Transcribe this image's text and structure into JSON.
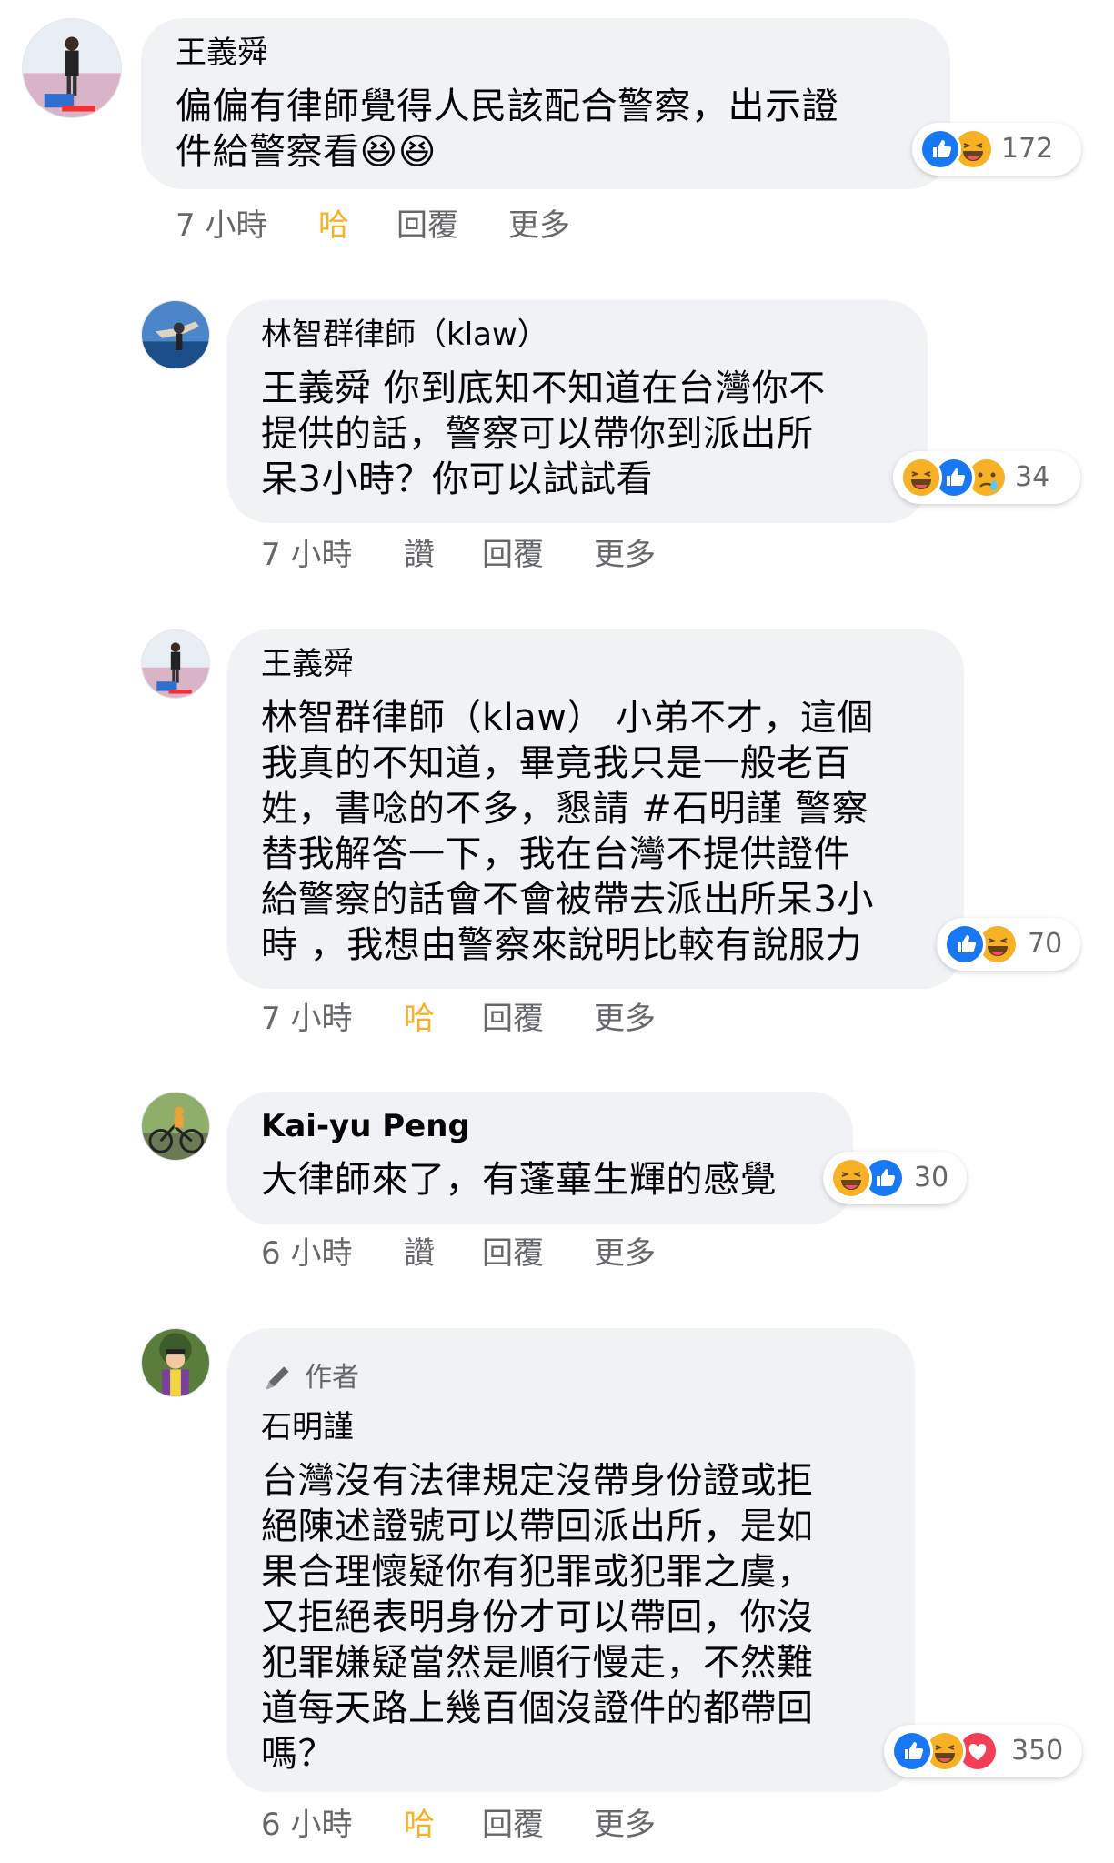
{
  "comments": [
    {
      "author": "王義舜",
      "text": "偏偏有律師覺得人民該配合警察，出示證\n件給警察看😆😆",
      "reactions": [
        "like",
        "haha"
      ],
      "reaction_count": "172",
      "time": "7 小時",
      "reaction_label": "哈",
      "reply_label": "回覆",
      "more_label": "更多"
    },
    {
      "author": "林智群律師（klaw）",
      "text": "王義舜 你到底知不知道在台灣你不\n提供的話，警察可以帶你到派出所\n呆3小時？你可以試試看",
      "reactions": [
        "haha",
        "like",
        "sad"
      ],
      "reaction_count": "34",
      "time": "7 小時",
      "reaction_label": "讚",
      "reply_label": "回覆",
      "more_label": "更多"
    },
    {
      "author": "王義舜",
      "text": "林智群律師（klaw） 小弟不才，這個\n我真的不知道，畢竟我只是一般老百\n姓，書唸的不多，懇請 #石明謹 警察\n替我解答一下，我在台灣不提供證件\n給警察的話會不會被帶去派出所呆3小\n時 ，我想由警察來說明比較有說服力",
      "reactions": [
        "like",
        "haha"
      ],
      "reaction_count": "70",
      "time": "7 小時",
      "reaction_label": "哈",
      "reply_label": "回覆",
      "more_label": "更多"
    },
    {
      "author": "Kai-yu Peng",
      "text": "大律師來了，有蓬蓽生輝的感覺",
      "reactions": [
        "haha",
        "like"
      ],
      "reaction_count": "30",
      "time": "6 小時",
      "reaction_label": "讚",
      "reply_label": "回覆",
      "more_label": "更多"
    },
    {
      "badge": "作者",
      "author": "石明謹",
      "text": "台灣沒有法律規定沒帶身份證或拒\n絕陳述證號可以帶回派出所，是如\n果合理懷疑你有犯罪或犯罪之虞，\n又拒絕表明身份才可以帶回，你沒\n犯罪嫌疑當然是順行慢走，不然難\n道每天路上幾百個沒證件的都帶回\n嗎？",
      "reactions": [
        "like",
        "haha",
        "love"
      ],
      "reaction_count": "350",
      "time": "6 小時",
      "reaction_label": "哈",
      "reply_label": "回覆",
      "more_label": "更多"
    }
  ],
  "colors": {
    "bubble": "#f0f2f5",
    "secondary_text": "#65676b",
    "like_blue": "#1877f2",
    "haha_yellow": "#f7b125",
    "love_red": "#f33e58"
  }
}
